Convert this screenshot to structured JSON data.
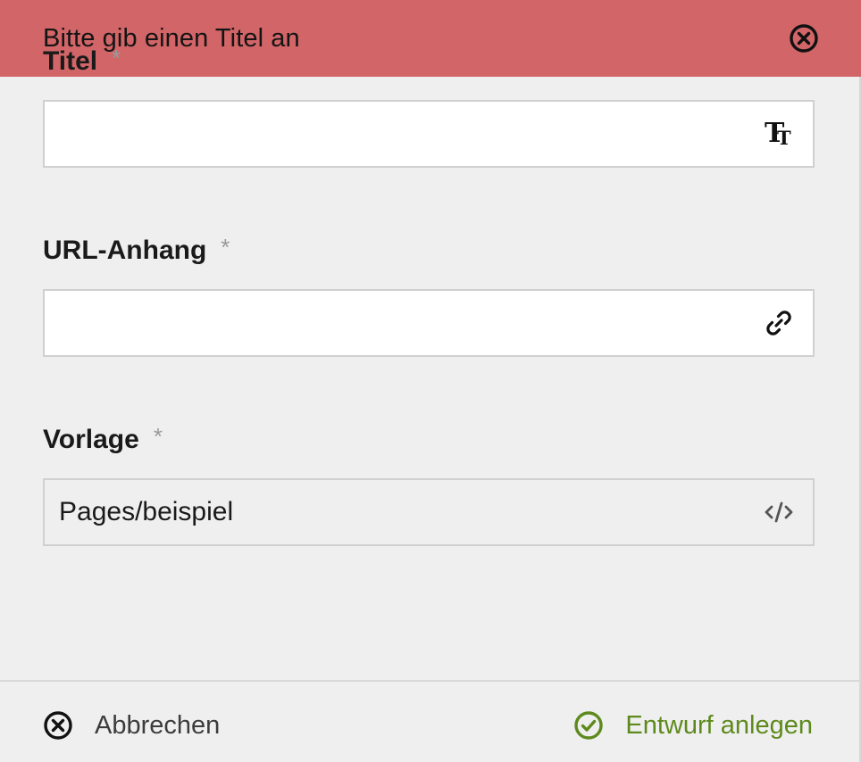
{
  "notification": {
    "message": "Bitte gib einen Titel an",
    "close_icon": "close-circle-icon",
    "background_color": "#d16567"
  },
  "fields": [
    {
      "label": "Titel",
      "required_marker": "*",
      "value": "",
      "placeholder": "",
      "icon": "text-title-icon"
    },
    {
      "label": "URL-Anhang",
      "required_marker": "*",
      "value": "",
      "placeholder": "",
      "icon": "link-icon"
    },
    {
      "label": "Vorlage",
      "required_marker": "*",
      "value": "Pages/beispiel",
      "placeholder": "",
      "icon": "code-icon",
      "readonly": true
    }
  ],
  "footer": {
    "cancel_label": "Abbrechen",
    "cancel_icon": "cancel-circle-icon",
    "submit_label": "Entwurf anlegen",
    "submit_icon": "check-circle-icon",
    "submit_color": "#5e8a1d"
  }
}
